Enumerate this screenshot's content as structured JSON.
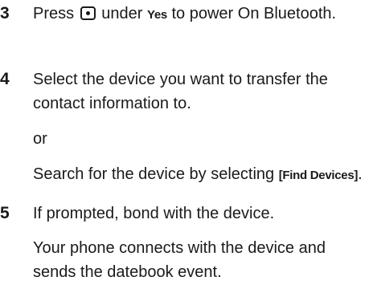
{
  "steps": [
    {
      "number": "3",
      "pre": "Press",
      "icon": "center-select-key-icon",
      "mid": "under",
      "keyword": "Yes",
      "post": "to power On Bluetooth."
    },
    {
      "number": "4",
      "text": "Select the device you want to transfer the contact information to.",
      "or": "or",
      "search_pre": "Search for the device by selecting",
      "search_option": "[Find Devices]",
      "search_post": "."
    },
    {
      "number": "5",
      "text": "If prompted, bond with the device.",
      "result": "Your phone connects with the device and sends the datebook event."
    }
  ]
}
